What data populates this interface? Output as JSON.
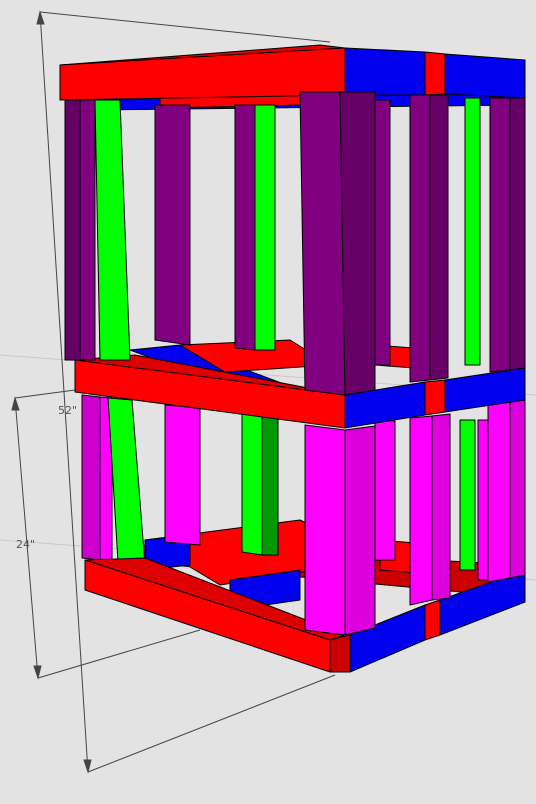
{
  "dimensions": {
    "total_height_label": "52\"",
    "lower_height_label": "24\""
  },
  "colors": {
    "background": "#e3e3e3",
    "rail": "#ff0000",
    "rail_end": "#0000ee",
    "upper_post": "#800080",
    "lower_post": "#ff00ff",
    "accent_post": "#00ff00",
    "edge": "#000000",
    "dimension_line": "#444444"
  },
  "model": {
    "tiers": [
      "upper-frame",
      "lower-frame"
    ],
    "style": "3d-wireframe-box"
  }
}
